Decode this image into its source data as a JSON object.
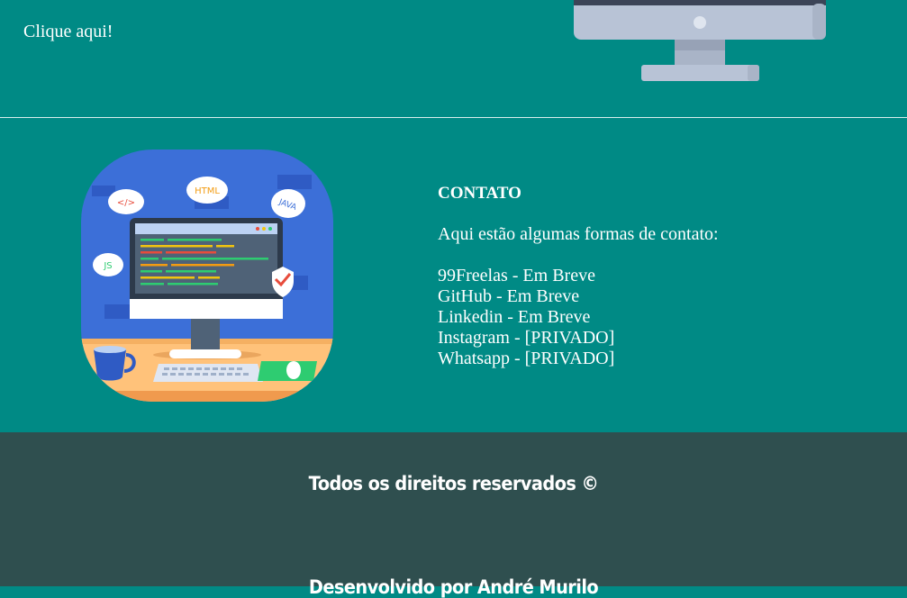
{
  "header": {
    "click_label": "Clique aqui!"
  },
  "illustration": {
    "bubbles": {
      "code": "</>",
      "html": "HTML",
      "java": "JAVA",
      "js": "JS"
    },
    "colors": {
      "bg": "#3c6fd8",
      "desk": "#ffc27a",
      "screen": "#4f6277"
    }
  },
  "contact": {
    "title": "CONTATO",
    "intro": "Aqui estão algumas formas de contato:",
    "items": [
      "99Freelas - Em Breve",
      "GitHub - Em Breve",
      "Linkedin - Em Breve",
      "Instagram - [PRIVADO]",
      "Whatsapp - [PRIVADO]"
    ]
  },
  "footer": {
    "rights": "Todos os direitos reservados ©",
    "developer": "Desenvolvido por André Murilo"
  },
  "colors": {
    "teal": "#008a85",
    "footer": "#2f4f4f"
  }
}
